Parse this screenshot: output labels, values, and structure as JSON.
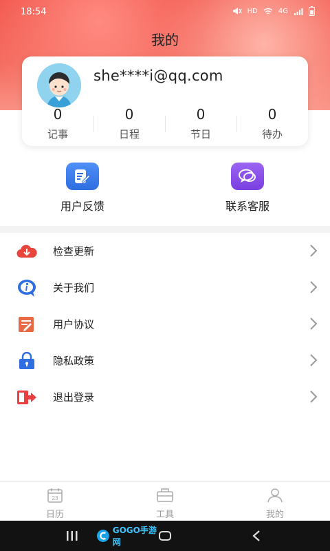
{
  "status_bar": {
    "time": "18:54",
    "network": "HD",
    "signal": "4G"
  },
  "header": {
    "title": "我的"
  },
  "profile": {
    "email": "she****i@qq.com",
    "stats": [
      {
        "value": "0",
        "label": "记事"
      },
      {
        "value": "0",
        "label": "日程"
      },
      {
        "value": "0",
        "label": "节日"
      },
      {
        "value": "0",
        "label": "待办"
      }
    ]
  },
  "actions": [
    {
      "label": "用户反馈",
      "icon": "feedback-edit-icon",
      "color": "#3d7cf0"
    },
    {
      "label": "联系客服",
      "icon": "chat-bubbles-icon",
      "color": "#8a52e8"
    }
  ],
  "menu": [
    {
      "label": "检查更新",
      "icon": "cloud-download-icon",
      "color": "#e8453c"
    },
    {
      "label": "关于我们",
      "icon": "info-icon",
      "color": "#2f6ee0"
    },
    {
      "label": "用户协议",
      "icon": "document-icon",
      "color": "#e86a45"
    },
    {
      "label": "隐私政策",
      "icon": "lock-icon",
      "color": "#2f6ee0"
    },
    {
      "label": "退出登录",
      "icon": "logout-icon",
      "color": "#e84040"
    }
  ],
  "tabbar": [
    {
      "label": "日历",
      "icon": "calendar-icon",
      "badge": "23"
    },
    {
      "label": "工具",
      "icon": "toolbox-icon"
    },
    {
      "label": "我的",
      "icon": "person-icon",
      "active": true
    }
  ],
  "watermark": {
    "text": "GOGO手游网"
  }
}
